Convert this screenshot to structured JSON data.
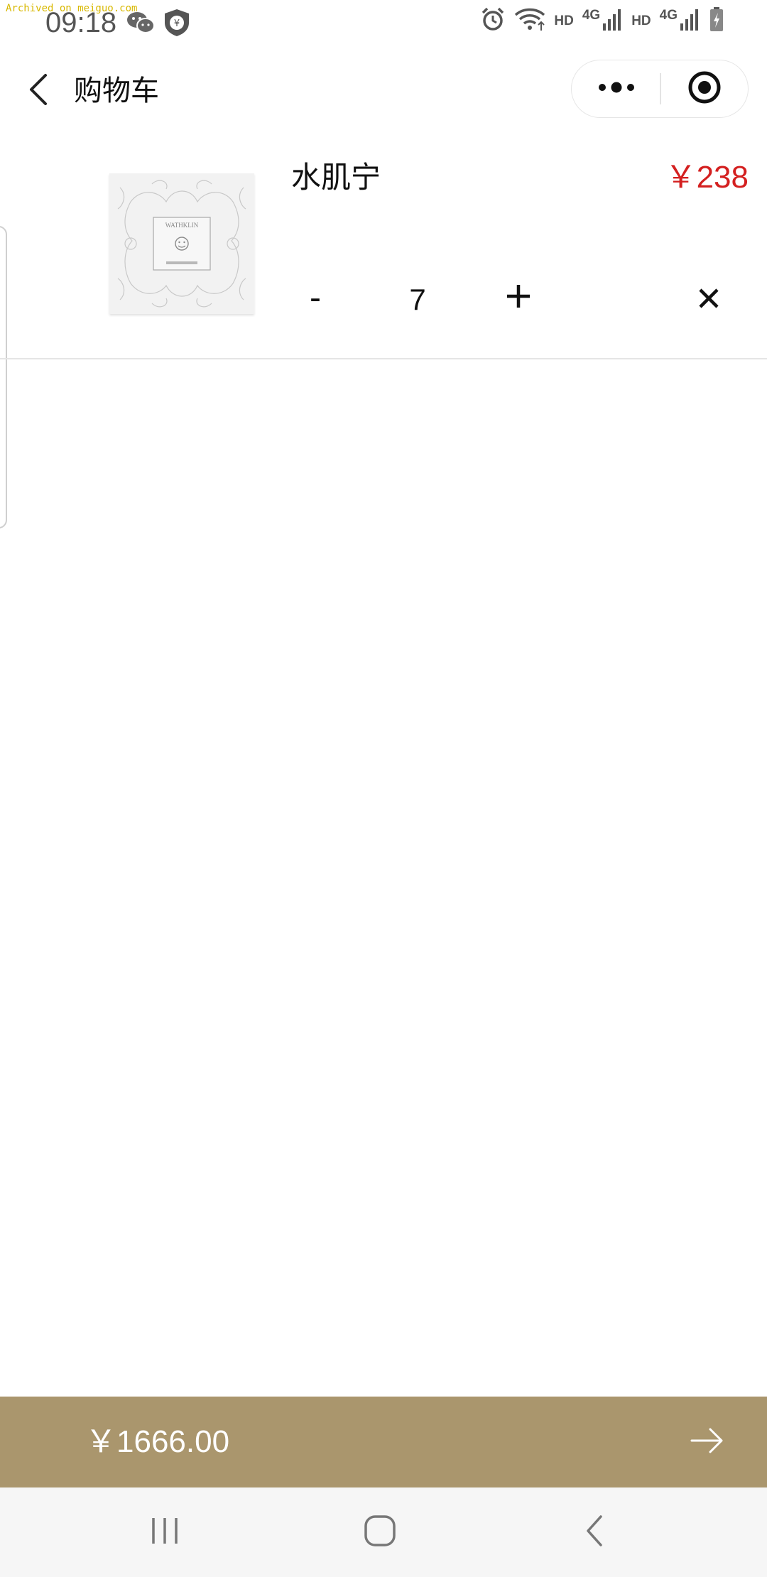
{
  "status_bar": {
    "watermark": "Archived on meiguo.com",
    "time": "09:18",
    "left_icons": [
      "wechat-icon",
      "wallet-shield-icon"
    ],
    "right_icons": [
      "alarm-icon",
      "wifi-icon",
      "signal-icon",
      "signal-icon",
      "battery-charging-icon"
    ],
    "hd_1": "HD",
    "net_1": "4G",
    "hd_2": "HD",
    "net_2": "4G"
  },
  "nav": {
    "back_icon": "chevron-left-icon",
    "title": "购物车",
    "capsule": {
      "more_icon": "more-dots-icon",
      "close_icon": "target-circle-icon"
    }
  },
  "cart": {
    "items": [
      {
        "name": "水肌宁",
        "price": "￥238",
        "quantity": "7",
        "minus_label": "-",
        "image": "product-box-image",
        "image_brand_text": "WATHKLIN"
      }
    ]
  },
  "checkout": {
    "total": "￥1666.00",
    "arrow_icon": "arrow-right-icon"
  },
  "system_nav": {
    "buttons": [
      "recent-apps-icon",
      "home-icon",
      "back-icon"
    ]
  },
  "colors": {
    "price_red": "#d42020",
    "checkout_bar": "#aa966d",
    "title_text": "#111111",
    "status_text": "#555555",
    "system_nav_bg": "#f6f6f6"
  }
}
